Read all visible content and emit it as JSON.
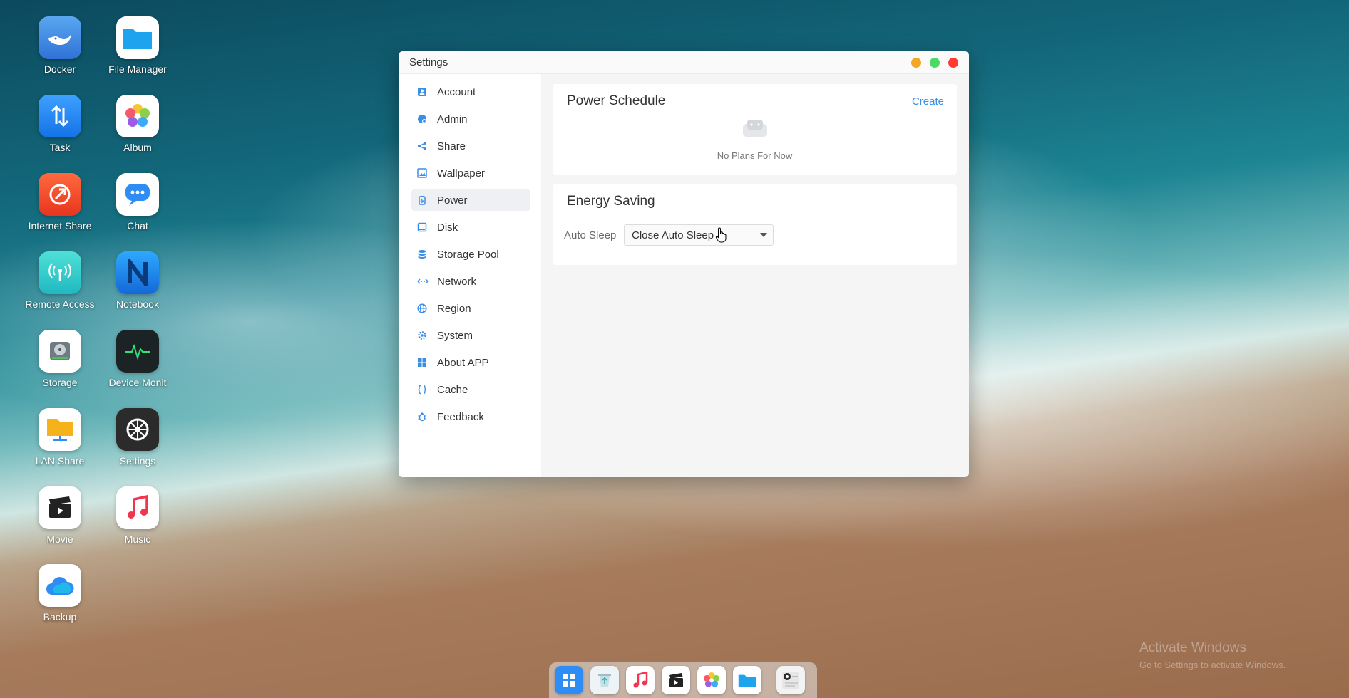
{
  "desktop": {
    "icons": [
      {
        "label": "Docker",
        "icon": "whale-icon",
        "color": "#3b82e0"
      },
      {
        "label": "File Manager",
        "icon": "folder-icon",
        "color": "#1ea4ef"
      },
      {
        "label": "Task",
        "icon": "transfer-arrows-icon",
        "color": "#1f8ef1"
      },
      {
        "label": "Album",
        "icon": "photos-flower-icon",
        "color": "#ffffff"
      },
      {
        "label": "Internet Share",
        "icon": "share-arrow-icon",
        "color": "#f0472f"
      },
      {
        "label": "Chat",
        "icon": "chat-bubble-icon",
        "color": "#2e8cf5"
      },
      {
        "label": "Remote Access",
        "icon": "broadcast-icon",
        "color": "#2ec7c9"
      },
      {
        "label": "Notebook",
        "icon": "notebook-icon",
        "color": "#1d8ff0"
      },
      {
        "label": "Storage",
        "icon": "hard-disk-icon",
        "color": "#ffffff"
      },
      {
        "label": "Device Monit",
        "icon": "heartbeat-icon",
        "color": "#1c2325"
      },
      {
        "label": "LAN Share",
        "icon": "lan-folder-icon",
        "color": "#ffffff"
      },
      {
        "label": "Settings",
        "icon": "gear-icon",
        "color": "#2b2b2b"
      },
      {
        "label": "Movie",
        "icon": "clapperboard-icon",
        "color": "#ffffff"
      },
      {
        "label": "Music",
        "icon": "music-note-icon",
        "color": "#ffffff"
      },
      {
        "label": "Backup",
        "icon": "cloud-icon",
        "color": "#ffffff"
      }
    ]
  },
  "window": {
    "title": "Settings",
    "controls": {
      "minimize_color": "#f5a623",
      "maximize_color": "#4cd964",
      "close_color": "#ff3b30"
    },
    "sidebar": {
      "items": [
        {
          "label": "Account",
          "icon": "account-icon"
        },
        {
          "label": "Admin",
          "icon": "admin-icon"
        },
        {
          "label": "Share",
          "icon": "share-icon"
        },
        {
          "label": "Wallpaper",
          "icon": "wallpaper-icon"
        },
        {
          "label": "Power",
          "icon": "power-icon",
          "active": true
        },
        {
          "label": "Disk",
          "icon": "disk-icon"
        },
        {
          "label": "Storage Pool",
          "icon": "database-icon"
        },
        {
          "label": "Network",
          "icon": "network-icon"
        },
        {
          "label": "Region",
          "icon": "globe-icon"
        },
        {
          "label": "System",
          "icon": "system-gear-icon"
        },
        {
          "label": "About APP",
          "icon": "windows-grid-icon"
        },
        {
          "label": "Cache",
          "icon": "braces-icon"
        },
        {
          "label": "Feedback",
          "icon": "bug-icon"
        }
      ]
    },
    "power_schedule": {
      "title": "Power Schedule",
      "create_label": "Create",
      "empty_text": "No Plans For Now"
    },
    "energy_saving": {
      "title": "Energy Saving",
      "auto_sleep_label": "Auto Sleep",
      "auto_sleep_value": "Close Auto Sleep"
    }
  },
  "dock": {
    "items": [
      {
        "icon": "windows-grid-icon"
      },
      {
        "icon": "recycle-bin-icon"
      },
      {
        "icon": "music-note-icon"
      },
      {
        "icon": "clapperboard-icon"
      },
      {
        "icon": "photos-flower-icon"
      },
      {
        "icon": "folder-icon"
      },
      {
        "icon": "settings-window-icon"
      }
    ]
  },
  "watermark": {
    "line1": "Activate Windows",
    "line2": "Go to Settings to activate Windows."
  },
  "accent_color": "#3a8ee6"
}
